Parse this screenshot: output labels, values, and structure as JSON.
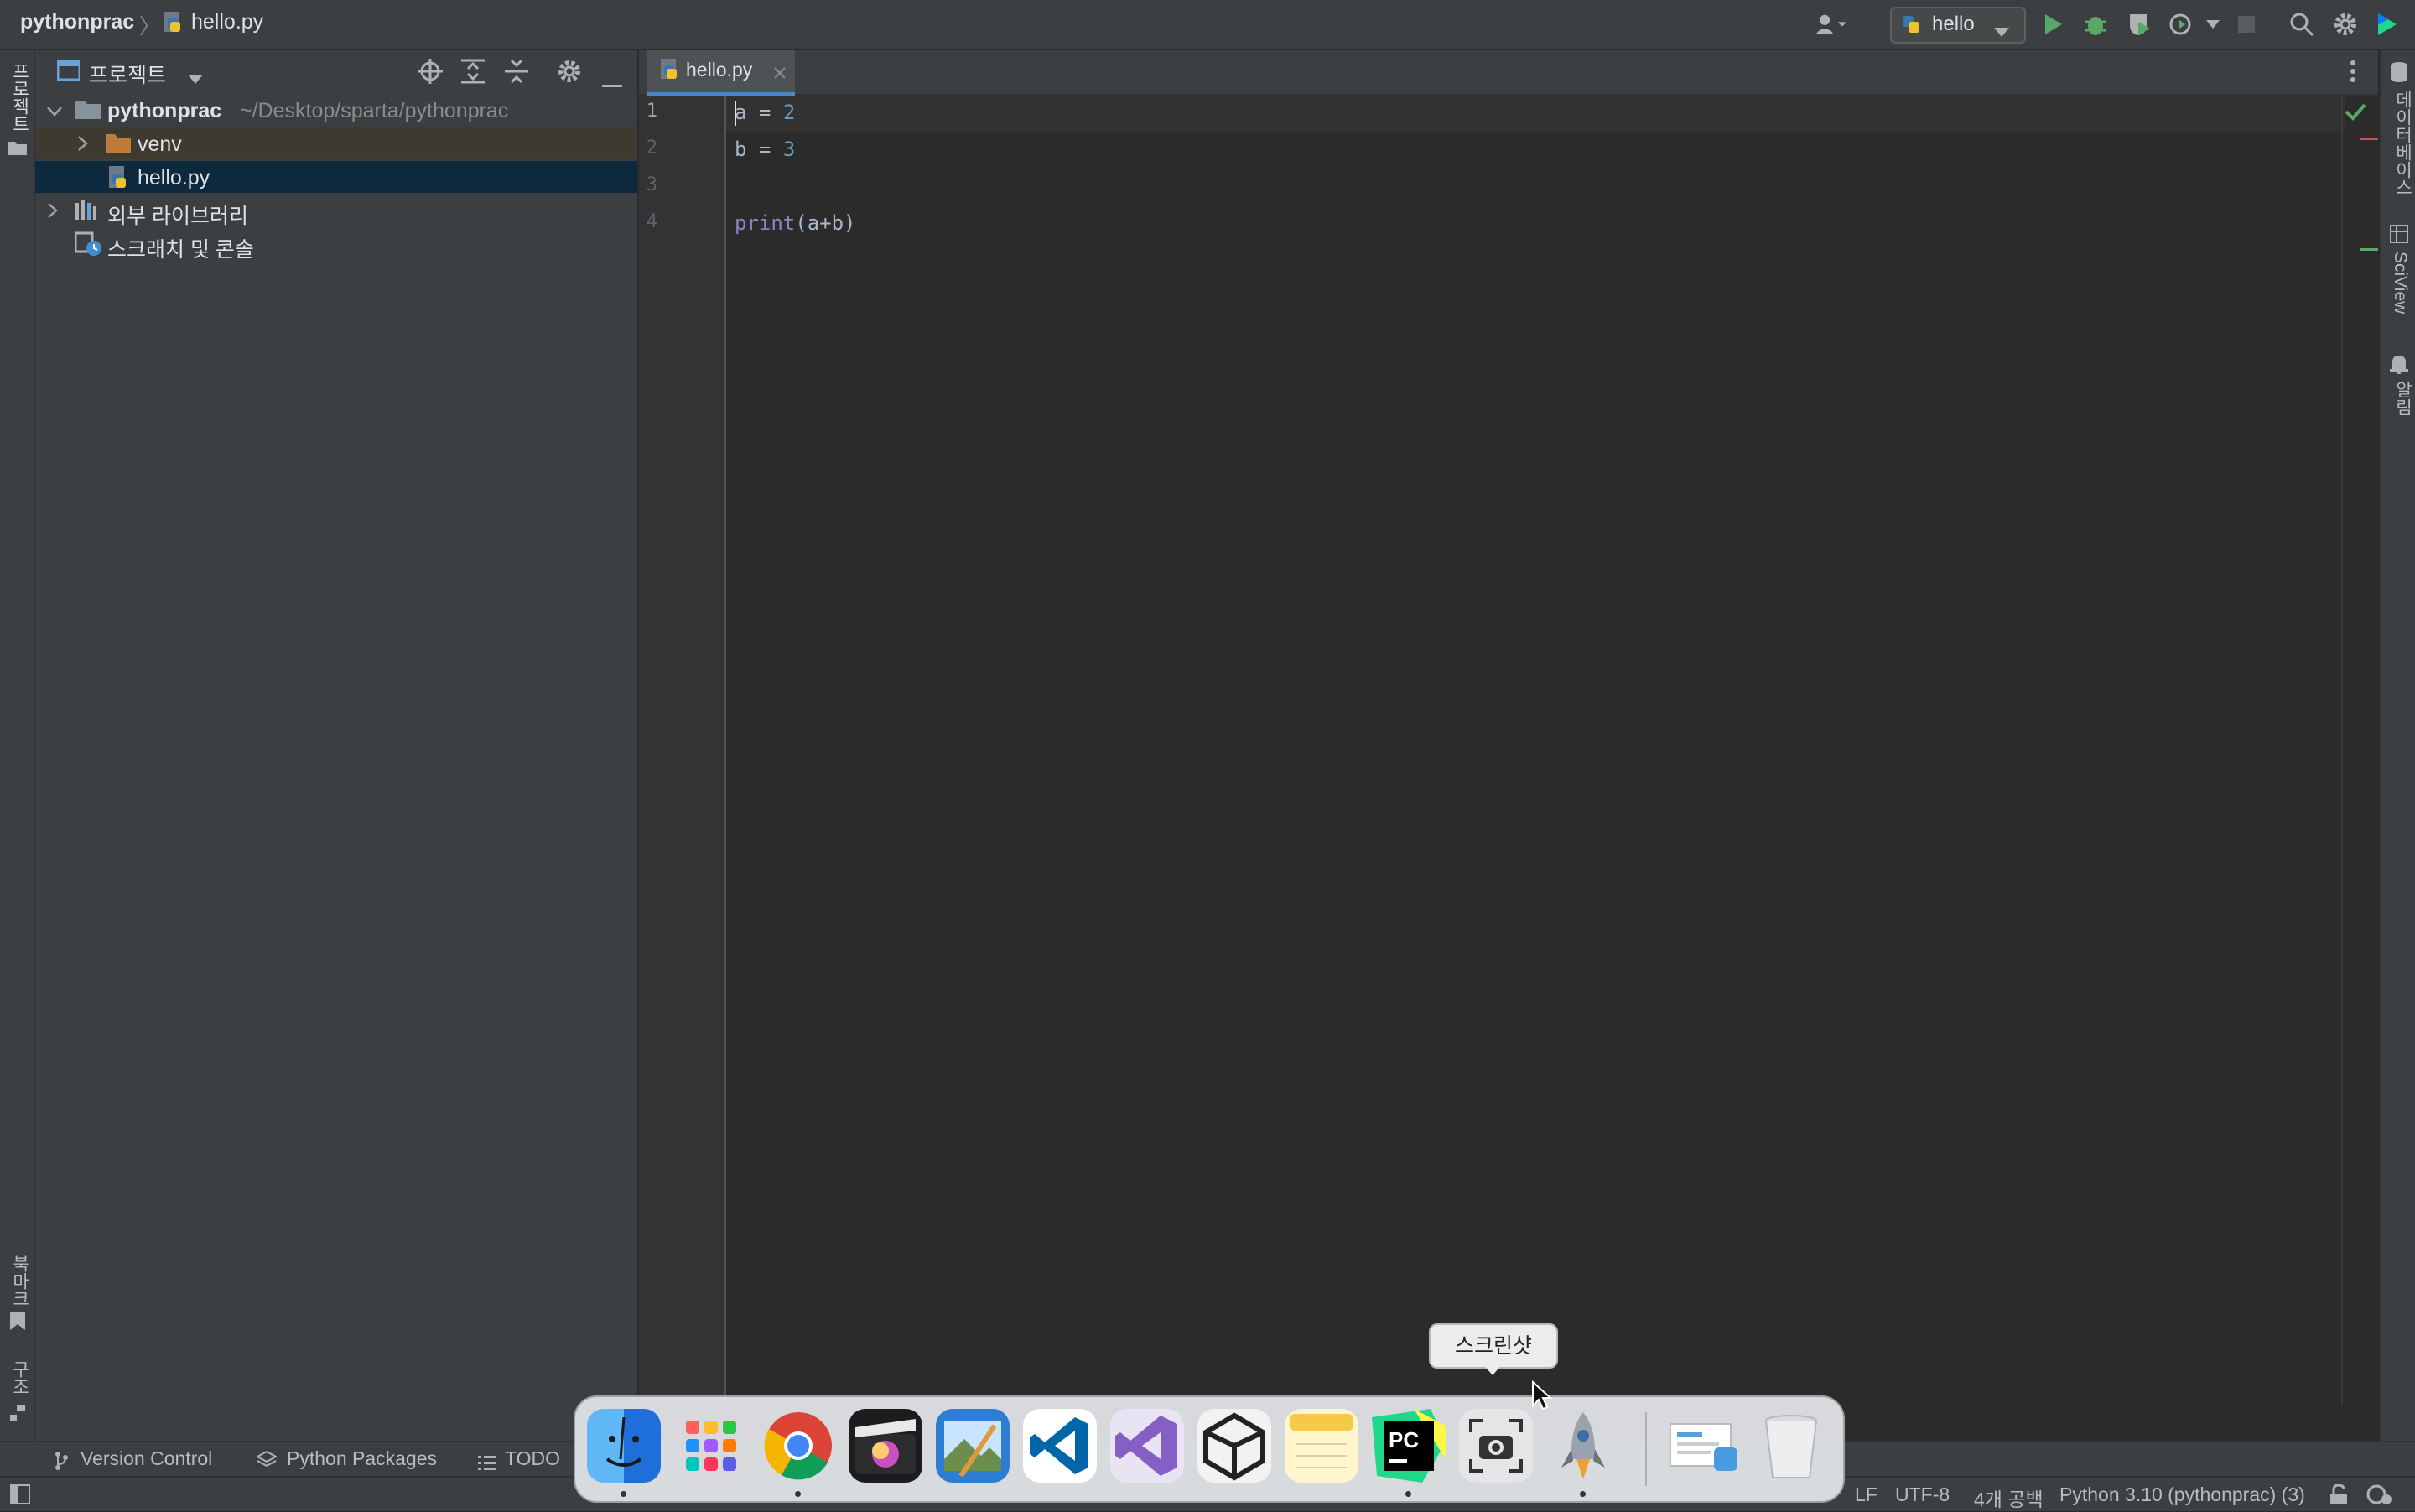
{
  "titlebar": {
    "project": "pythonprac",
    "file": "hello.py",
    "run_config": "hello"
  },
  "left_stripe": {
    "project_label": "프로젝트",
    "bookmarks_label": "북마크",
    "structure_label": "구조"
  },
  "project_pane": {
    "title": "프로젝트",
    "tree": {
      "root_name": "pythonprac",
      "root_path": "~/Desktop/sparta/pythonprac",
      "venv": "venv",
      "file": "hello.py",
      "external_libs": "외부 라이브러리",
      "scratches": "스크래치 및 콘솔"
    }
  },
  "editor": {
    "tab_label": "hello.py",
    "line_numbers": [
      "1",
      "2",
      "3",
      "4"
    ],
    "lines": {
      "l1_var": "a",
      "l1_op": " = ",
      "l1_num": "2",
      "l2_var": "b",
      "l2_op": " = ",
      "l2_num": "3",
      "l4_fn": "print",
      "l4_args": "(a+b)"
    }
  },
  "right_stripe": {
    "database_label": "데이터베이스",
    "sciview_label": "SciView",
    "notifications_label": "알림"
  },
  "bottom_tools": {
    "version_control": "Version Control",
    "python_packages": "Python Packages",
    "todo": "TODO"
  },
  "status_bar": {
    "line_sep": "LF",
    "encoding": "UTF-8",
    "indent": "4개 공백",
    "interpreter": "Python 3.10 (pythonprac) (3)"
  },
  "dock": {
    "tooltip": "스크린샷",
    "apps": [
      "finder-icon",
      "launchpad-icon",
      "chrome-icon",
      "final-cut-icon",
      "preview-icon",
      "vscode-icon",
      "visual-studio-icon",
      "unity-icon",
      "notes-icon",
      "pycharm-icon",
      "screenshot-icon",
      "rocket-icon",
      "downloads-stack-icon",
      "trash-icon"
    ]
  },
  "colors": {
    "accent": "#4a88c7",
    "run_green": "#59a869",
    "folder_orange": "#c17a3a",
    "selected_row": "#0d293e"
  }
}
